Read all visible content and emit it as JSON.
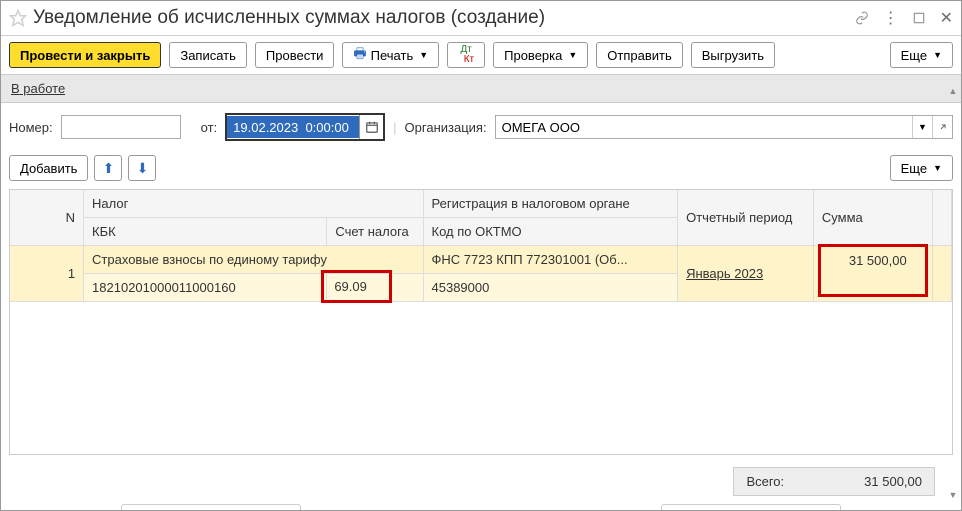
{
  "title": "Уведомление об исчисленных суммах налогов (создание)",
  "toolbar": {
    "post_close": "Провести и закрыть",
    "save": "Записать",
    "post": "Провести",
    "print": "Печать",
    "check": "Проверка",
    "send": "Отправить",
    "export": "Выгрузить",
    "more": "Еще"
  },
  "status": "В работе",
  "form": {
    "number_label": "Номер:",
    "number_value": "",
    "from_label": "от:",
    "date_value": "19.02.2023  0:00:00",
    "org_label": "Организация:",
    "org_value": "ОМЕГА ООО"
  },
  "table_toolbar": {
    "add": "Добавить",
    "more": "Еще"
  },
  "table": {
    "head": {
      "n": "N",
      "tax": "Налог",
      "reg": "Регистрация в налоговом органе",
      "period": "Отчетный период",
      "sum": "Сумма",
      "kbk": "КБК",
      "acct": "Счет налога",
      "oktmo": "Код по ОКТМО"
    },
    "rows": [
      {
        "n": "1",
        "tax": "Страховые взносы по единому тарифу",
        "reg": "ФНС 7723 КПП 772301001 (Об...",
        "period": "Январь 2023",
        "sum": "31 500,00",
        "kbk": "18210201000011000160",
        "acct": "69.09",
        "oktmo": "45389000"
      }
    ]
  },
  "total": {
    "label": "Всего:",
    "value": "31 500,00"
  }
}
